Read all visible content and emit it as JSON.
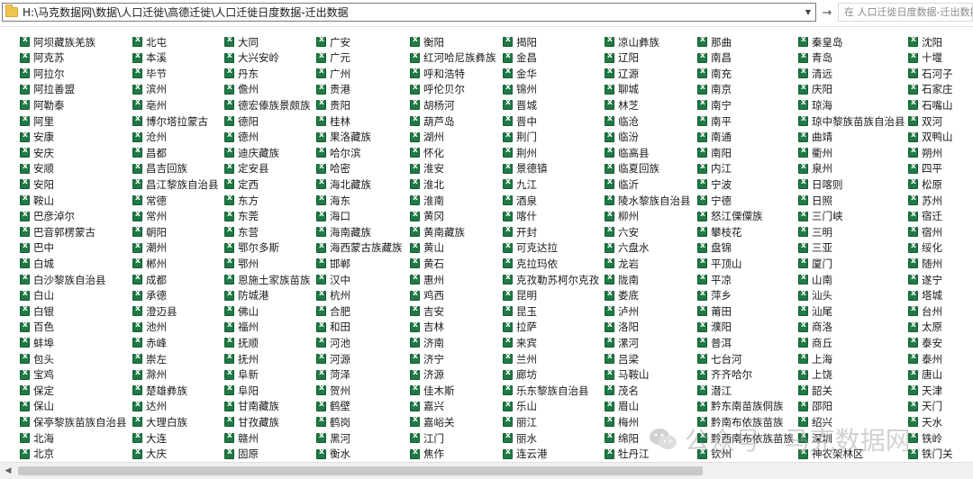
{
  "address_bar": {
    "path": "H:\\马克数据网\\数据\\人口迁徙\\高德迁徙\\人口迁徙日度数据-迁出数据",
    "search_placeholder": "在 人口迁徙日度数据-迁出数据 中搜索"
  },
  "file_columns": [
    [
      "阿坝藏族羌族",
      "阿克苏",
      "阿拉尔",
      "阿拉善盟",
      "阿勒泰",
      "阿里",
      "安康",
      "安庆",
      "安顺",
      "安阳",
      "鞍山",
      "巴彦淖尔",
      "巴音郭楞蒙古",
      "巴中",
      "白城",
      "白沙黎族自治县",
      "白山",
      "白银",
      "百色",
      "蚌埠",
      "包头",
      "宝鸡",
      "保定",
      "保山",
      "保亭黎族苗族自治县",
      "北海",
      "北京"
    ],
    [
      "北屯",
      "本溪",
      "毕节",
      "滨州",
      "亳州",
      "博尔塔拉蒙古",
      "沧州",
      "昌都",
      "昌吉回族",
      "昌江黎族自治县",
      "常德",
      "常州",
      "朝阳",
      "潮州",
      "郴州",
      "成都",
      "承德",
      "澄迈县",
      "池州",
      "赤峰",
      "崇左",
      "滁州",
      "楚雄彝族",
      "达州",
      "大理白族",
      "大连",
      "大庆"
    ],
    [
      "大同",
      "大兴安岭",
      "丹东",
      "儋州",
      "德宏傣族景颇族",
      "德阳",
      "德州",
      "迪庆藏族",
      "定安县",
      "定西",
      "东方",
      "东莞",
      "东营",
      "鄂尔多斯",
      "鄂州",
      "恩施土家族苗族",
      "防城港",
      "佛山",
      "福州",
      "抚顺",
      "抚州",
      "阜新",
      "阜阳",
      "甘南藏族",
      "甘孜藏族",
      "赣州",
      "固原"
    ],
    [
      "广安",
      "广元",
      "广州",
      "贵港",
      "贵阳",
      "桂林",
      "果洛藏族",
      "哈尔滨",
      "哈密",
      "海北藏族",
      "海东",
      "海口",
      "海南藏族",
      "海西蒙古族藏族",
      "邯郸",
      "汉中",
      "杭州",
      "合肥",
      "和田",
      "河池",
      "河源",
      "菏泽",
      "贺州",
      "鹤壁",
      "鹤岗",
      "黑河",
      "衡水"
    ],
    [
      "衡阳",
      "红河哈尼族彝族",
      "呼和浩特",
      "呼伦贝尔",
      "胡杨河",
      "葫芦岛",
      "湖州",
      "怀化",
      "淮安",
      "淮北",
      "淮南",
      "黄冈",
      "黄南藏族",
      "黄山",
      "黄石",
      "惠州",
      "鸡西",
      "吉安",
      "吉林",
      "济南",
      "济宁",
      "济源",
      "佳木斯",
      "嘉兴",
      "嘉峪关",
      "江门",
      "焦作"
    ],
    [
      "揭阳",
      "金昌",
      "金华",
      "锦州",
      "晋城",
      "晋中",
      "荆门",
      "荆州",
      "景德镇",
      "九江",
      "酒泉",
      "喀什",
      "开封",
      "可克达拉",
      "克拉玛依",
      "克孜勒苏柯尔克孜",
      "昆明",
      "昆玉",
      "拉萨",
      "来宾",
      "兰州",
      "廊坊",
      "乐东黎族自治县",
      "乐山",
      "丽江",
      "丽水",
      "连云港"
    ],
    [
      "凉山彝族",
      "辽阳",
      "辽源",
      "聊城",
      "林芝",
      "临沧",
      "临汾",
      "临高县",
      "临夏回族",
      "临沂",
      "陵水黎族自治县",
      "柳州",
      "六安",
      "六盘水",
      "龙岩",
      "陇南",
      "娄底",
      "泸州",
      "洛阳",
      "漯河",
      "吕梁",
      "马鞍山",
      "茂名",
      "眉山",
      "梅州",
      "绵阳",
      "牡丹江"
    ],
    [
      "那曲",
      "南昌",
      "南充",
      "南京",
      "南宁",
      "南平",
      "南通",
      "南阳",
      "内江",
      "宁波",
      "宁德",
      "怒江傈僳族",
      "攀枝花",
      "盘锦",
      "平顶山",
      "平凉",
      "萍乡",
      "莆田",
      "濮阳",
      "普洱",
      "七台河",
      "齐齐哈尔",
      "潜江",
      "黔东南苗族侗族",
      "黔南布依族苗族",
      "黔西南布依族苗族",
      "钦州"
    ],
    [
      "秦皇岛",
      "青岛",
      "清远",
      "庆阳",
      "琼海",
      "琼中黎族苗族自治县",
      "曲靖",
      "衢州",
      "泉州",
      "日喀则",
      "日照",
      "三门峡",
      "三明",
      "三亚",
      "厦门",
      "山南",
      "汕头",
      "汕尾",
      "商洛",
      "商丘",
      "上海",
      "上饶",
      "韶关",
      "邵阳",
      "绍兴",
      "深圳",
      "神农架林区"
    ],
    [
      "沈阳",
      "十堰",
      "石河子",
      "石家庄",
      "石嘴山",
      "双河",
      "双鸭山",
      "朔州",
      "四平",
      "松原",
      "苏州",
      "宿迁",
      "宿州",
      "绥化",
      "随州",
      "遂宁",
      "塔城",
      "台州",
      "太原",
      "泰安",
      "泰州",
      "唐山",
      "天津",
      "天门",
      "天水",
      "铁岭",
      "铁门关"
    ]
  ],
  "watermark": {
    "text": "公众号 · 马克数据网"
  },
  "colors": {
    "excel_green": "#1f7a45",
    "folder_yellow": "#f0c44c"
  }
}
